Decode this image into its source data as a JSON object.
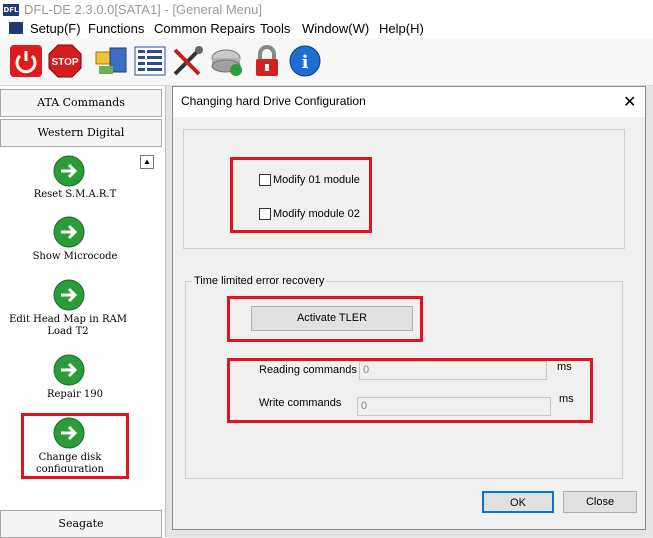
{
  "window": {
    "title": "DFL-DE 2.3.0.0[SATA1] - [General Menu]",
    "icon_text": "DFL"
  },
  "menu": [
    "Setup(F)",
    "Functions",
    "Common Repairs",
    "Tools",
    "Window(W)",
    "Help(H)"
  ],
  "toolbar": [
    "power-icon",
    "stop-icon",
    "explorer-icon",
    "table-icon",
    "tools-icon",
    "disk-icon",
    "lock-icon",
    "info-icon"
  ],
  "toolbar_stop_text": "STOP",
  "toolbar_info_text": "i",
  "sidebar": {
    "headers": [
      "ATA Commands",
      "Western Digital",
      "Seagate"
    ],
    "items": [
      {
        "label": "Reset S.M.A.R.T"
      },
      {
        "label": "Show Microcode"
      },
      {
        "label": "Edit Head Map in RAM Load T2"
      },
      {
        "label": "Repair 190"
      },
      {
        "label": "Change disk configuration"
      }
    ],
    "scroll_glyph": "▲"
  },
  "dialog": {
    "title": "Changing hard Drive Configuration",
    "close_glyph": "✕",
    "checkboxes": [
      "Modify 01 module",
      "Modify module 02"
    ],
    "tler_group_label": "Time limited error recovery",
    "activate_button": "Activate TLER",
    "fields": [
      {
        "label": "Reading commands",
        "value": "0",
        "unit": "ms"
      },
      {
        "label": "Write commands",
        "value": "0",
        "unit": "ms"
      }
    ],
    "ok_button": "OK",
    "close_button": "Close"
  },
  "colors": {
    "highlight": "#e0141e",
    "arrow_green": "#2a9d3a"
  }
}
